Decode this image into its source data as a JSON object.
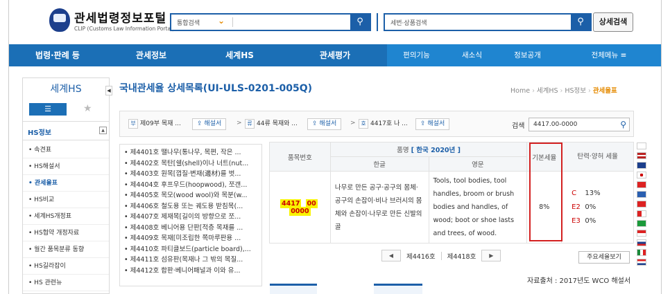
{
  "header": {
    "logo_title": "관세법령정보포털",
    "logo_sub": "CLIP (Customs Law Information Portal)",
    "search1_select": "통합검색",
    "search2_placeholder": "세번·상품검색",
    "detail_search": "상세검색"
  },
  "nav": {
    "main": [
      "법령·판례 등",
      "관세정보",
      "세계HS",
      "관세평가"
    ],
    "sub": [
      "편의기능",
      "새소식",
      "정보공개",
      "전체메뉴 ≡"
    ]
  },
  "sidebar": {
    "title": "세계HS",
    "section": "HS정보",
    "items": [
      "속견표",
      "HS해설서",
      "관세율표",
      "HS비교",
      "세계HS개정표",
      "HS협약 개정자료",
      "월간 품목분류 동향",
      "HS길라잡이",
      "HS 관련뉴"
    ]
  },
  "page": {
    "title": "국내관세율 상세목록(UI-ULS-0201-005Q)",
    "breadcrumb": [
      "Home",
      "세계HS",
      "HS정보",
      "관세율표"
    ]
  },
  "toolbar": {
    "part_tag": "부",
    "part_text": "제09부 목재 ...",
    "chapter_tag": "류",
    "chapter_text": "44류 목재와 ...",
    "heading_tag": "호",
    "heading_text": "4417호 나 ...",
    "explain_btn": "해설서",
    "search_label": "검색",
    "search_value": "4417.00-0000"
  },
  "headings": [
    "제4401호 땔나무(통나무, 목편, 작은 ...",
    "제4402호 목탄[쉘(shell)이나 너트(nut...",
    "제4403호 원목[껍질·변재(邊材)를 벗...",
    "제4404호 후프우드(hoopwood), 쪼갠...",
    "제4405호 목모(wood wool)와 목분(w...",
    "제4406호 철도용 또는 궤도용 받침목(...",
    "제4407호 제재목[길이의 방향으로 쪼...",
    "제4408호 베니어용 단판[적층 목재를 ...",
    "제4409호 목재[미조립한 쪽마루판용 ...",
    "제4410호 파티클보드(particle board),...",
    "제4411호 섬유판(목재나 그 밖의 목질...",
    "제4412호 합판·베니어패널과 이와 유..."
  ],
  "table": {
    "col_item_no": "품목번호",
    "col_name": "품명",
    "lang_year": "[ 한국  2020년 ]",
    "col_korean": "한글",
    "col_english": "영문",
    "col_basic_rate": "기본세율",
    "col_flex_rate": "탄력·양허 세율",
    "code_parts": [
      "4417",
      "00",
      "0000"
    ],
    "korean_desc": "나무로 만든 공구·공구의 몸체·공구의 손잡이·비나 브러시의 몸체와 손잡이·나무로 만든 신발의 골",
    "english_desc": "Tools, tool bodies, tool handles, broom or brush bodies and handles, of wood; boot or shoe lasts and trees, of wood.",
    "basic_rate": "8%",
    "flex_rates": [
      {
        "code": "C",
        "rate": "13%"
      },
      {
        "code": "E2",
        "rate": "0%"
      },
      {
        "code": "E3",
        "rate": "0%"
      }
    ]
  },
  "pager": {
    "prev_label": "제4416호",
    "next_label": "제4418호"
  },
  "key_rate_btn": "주요세율보기",
  "source": "자료출처 : 2017년도 WCO 해설서",
  "colors": {
    "brand_blue": "#1c5fa8",
    "nav_blue": "#1b6fb6",
    "highlight_yellow": "#f9f300",
    "red_box": "#d32020",
    "accent_orange": "#e58a00"
  }
}
